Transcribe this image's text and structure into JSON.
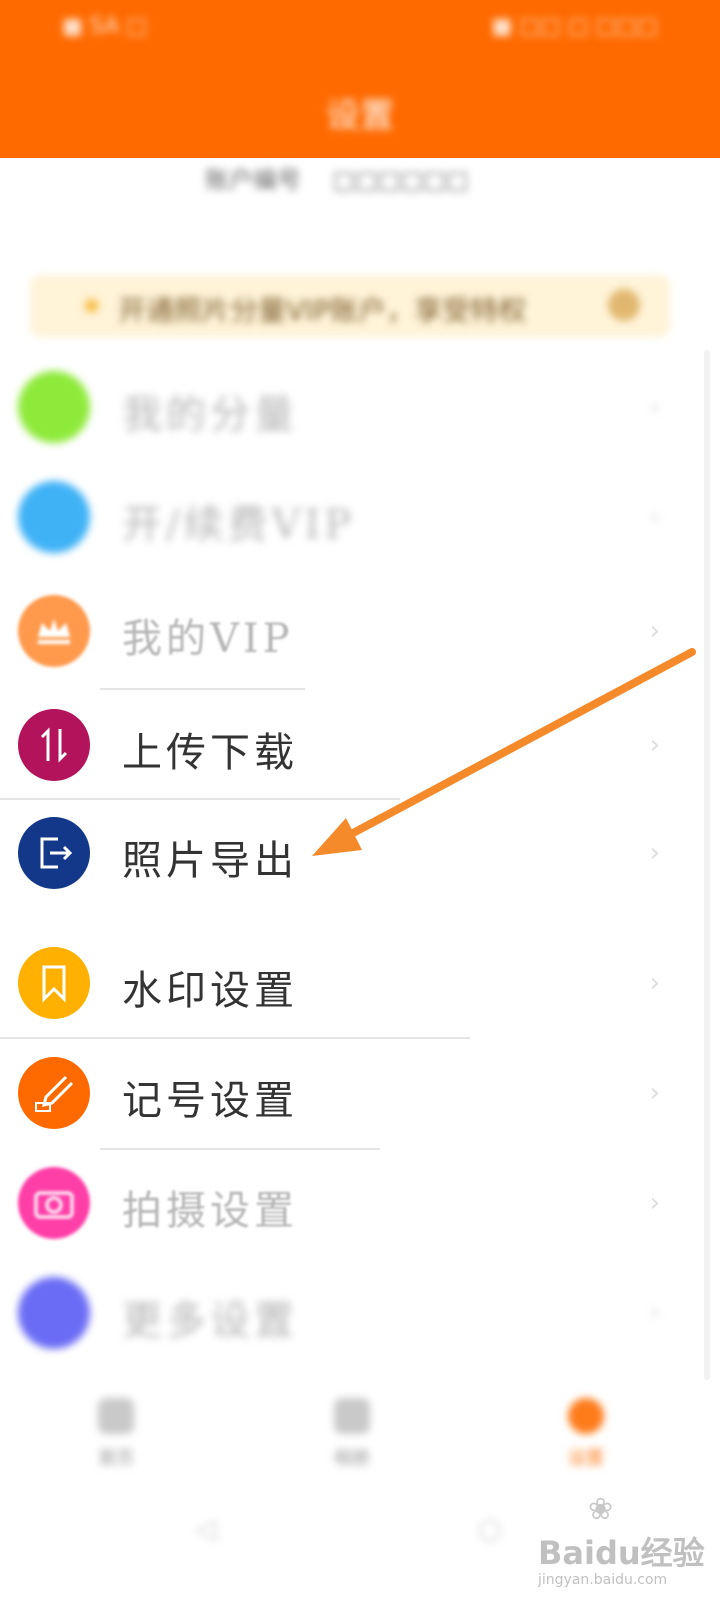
{
  "status_bar": {
    "left": "■ SA □",
    "right": "■ □□ □ □□□"
  },
  "header": {
    "title": "设置"
  },
  "account": {
    "label": "账户编号",
    "value": "□□□□□□"
  },
  "vip_banner": {
    "text": "开通照片分量VIP账户，享受特权"
  },
  "menu": [
    {
      "label": "我的分量",
      "faded": true,
      "color": "#8eea3a",
      "icon": "green-circle-icon"
    },
    {
      "label": "开/续费VIP",
      "faded": true,
      "color": "#3fb2f6",
      "icon": "refresh-icon"
    },
    {
      "label": "我的VIP",
      "faded": true,
      "color": "#ff9a4d",
      "icon": "crown-icon"
    },
    {
      "label": "上传下载",
      "faded": false,
      "color": "#b3135a",
      "icon": "upload-download-icon"
    },
    {
      "label": "照片导出",
      "faded": false,
      "color": "#13388a",
      "icon": "export-icon"
    },
    {
      "label": "水印设置",
      "faded": false,
      "color": "#ffb000",
      "icon": "bookmark-icon"
    },
    {
      "label": "记号设置",
      "faded": false,
      "color": "#ff6a00",
      "icon": "marker-icon"
    },
    {
      "label": "拍摄设置",
      "faded": true,
      "color": "#ff3fa8",
      "icon": "camera-icon"
    },
    {
      "label": "更多设置",
      "faded": true,
      "color": "#6a6cf5",
      "icon": "more-settings-icon"
    }
  ],
  "bottom_nav": [
    {
      "label": "首页",
      "active": false
    },
    {
      "label": "相册",
      "active": false
    },
    {
      "label": "设置",
      "active": true
    }
  ],
  "system_nav": {
    "back": "◁",
    "home": "○"
  },
  "watermark": {
    "brand": "Bai​du经验",
    "site": "jingyan.baidu.com",
    "paw": "❀"
  },
  "colors": {
    "accent": "#ff6a00",
    "arrow": "#f58a2a"
  }
}
